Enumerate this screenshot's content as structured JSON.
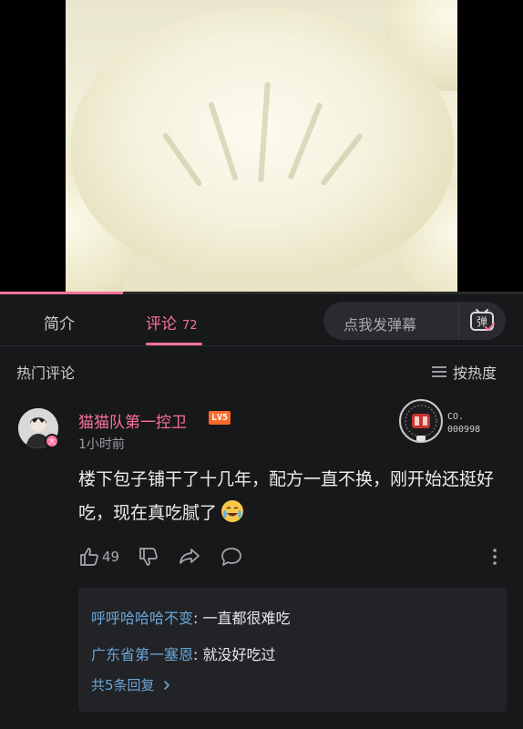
{
  "video": {
    "progress_fraction": 0.235
  },
  "tabs": {
    "intro_label": "简介",
    "comments_label": "评论",
    "comments_count": "72"
  },
  "danmaku": {
    "placeholder": "点我发弹幕",
    "button_glyph": "弹"
  },
  "comments_section": {
    "title": "热门评论",
    "sort_label": "按热度"
  },
  "comment": {
    "username": "猫猫队第一控卫",
    "level": "LV5",
    "avatar_badge": "大",
    "timestamp": "1小时前",
    "fan_label_line1": "CO.",
    "fan_label_line2": "000998",
    "text": "楼下包子铺干了十几年，配方一直不换，刚开始还挺好吃，现在真吃腻了",
    "likes": "49"
  },
  "replies": [
    {
      "name": "呼呼哈哈哈不变",
      "text": ": 一直都很难吃"
    },
    {
      "name": "广东省第一塞恩",
      "text": ": 就没好吃过"
    }
  ],
  "more_replies_label": "共5条回复",
  "colors": {
    "accent": "#fb7299",
    "link": "#6aa6d9",
    "background": "#17181a"
  }
}
